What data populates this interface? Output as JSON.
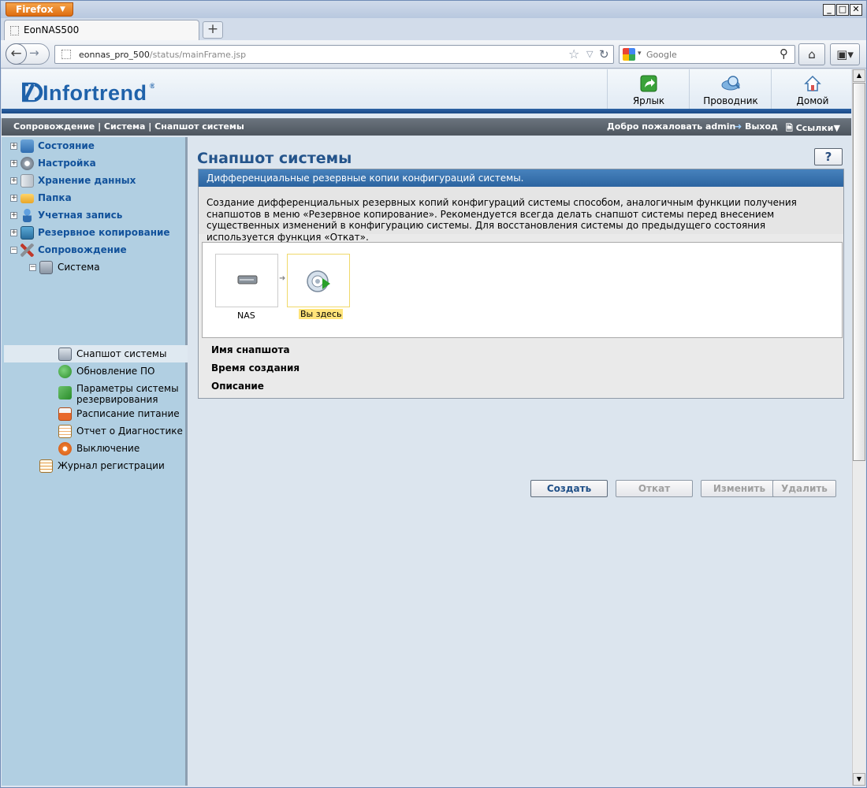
{
  "browser": {
    "menu_button": "Firefox",
    "tab_title": "EonNAS500",
    "url_host": "eonnas_pro_500",
    "url_path": "/status/mainFrame.jsp",
    "search_placeholder": "Google"
  },
  "header": {
    "logo": "Infortrend",
    "logo_mark": "®",
    "buttons": [
      {
        "label": "Ярлык",
        "icon": "shortcut-icon"
      },
      {
        "label": "Проводник",
        "icon": "explorer-icon"
      },
      {
        "label": "Домой",
        "icon": "home-icon"
      }
    ]
  },
  "topbar": {
    "breadcrumb": "Сопровождение | Система | Снапшот системы",
    "welcome": "Добро пожаловать admin",
    "logout": "Выход",
    "links": "Ссылки▼"
  },
  "sidebar": {
    "items": [
      {
        "label": "Состояние",
        "toggle": "+"
      },
      {
        "label": "Настройка",
        "toggle": "+"
      },
      {
        "label": "Хранение данных",
        "toggle": "+"
      },
      {
        "label": "Папка",
        "toggle": "+"
      },
      {
        "label": "Учетная запись",
        "toggle": "+"
      },
      {
        "label": "Резервное копирование",
        "toggle": "+"
      },
      {
        "label": "Сопровождение",
        "toggle": "−"
      }
    ],
    "system": {
      "label": "Система",
      "toggle": "−"
    },
    "system_children": [
      {
        "label": "Снапшот системы"
      },
      {
        "label": "Обновление ПО"
      },
      {
        "label": "Параметры системы резервирования"
      },
      {
        "label": "Расписание питание"
      },
      {
        "label": "Отчет о Диагностике"
      },
      {
        "label": "Выключение"
      }
    ],
    "log": {
      "label": "Журнал регистрации"
    }
  },
  "main": {
    "title": "Снапшот системы",
    "help": "?",
    "panel_header": "Дифференциальные резервные копии конфигураций системы.",
    "description": "Создание дифференциальных резервных копий конфигураций системы способом, аналогичным функции получения снапшотов в меню «Резервное копирование». Рекомендуется всегда делать снапшот системы перед внесением существенных изменений в конфигурацию системы. Для восстановления системы до предыдущего состояния используется функция «Откат».",
    "timeline": {
      "nas_label": "NAS",
      "here_label": "Вы здесь"
    },
    "fields": {
      "name": "Имя снапшота",
      "created": "Время создания",
      "description": "Описание"
    },
    "buttons": {
      "create": "Создать",
      "rollback": "Откат",
      "edit": "Изменить",
      "delete": "Удалить"
    }
  }
}
